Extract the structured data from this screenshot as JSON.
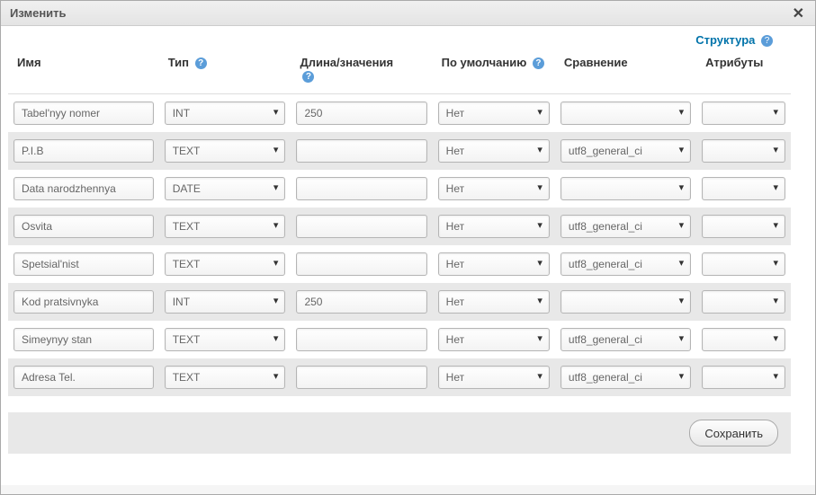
{
  "dialog": {
    "title": "Изменить",
    "close_glyph": "✕"
  },
  "structure_link": {
    "label": "Структура",
    "help": "?"
  },
  "headers": {
    "name": "Имя",
    "type": "Тип",
    "length": "Длина/значения",
    "default": "По умолчанию",
    "collation": "Сравнение",
    "attributes": "Атрибуты",
    "help": "?"
  },
  "rows": [
    {
      "name": "Tabel'nyy nomer",
      "type": "INT",
      "length": "250",
      "default": "Нет",
      "collation": "",
      "attributes": ""
    },
    {
      "name": "P.I.B",
      "type": "TEXT",
      "length": "",
      "default": "Нет",
      "collation": "utf8_general_ci",
      "attributes": ""
    },
    {
      "name": "Data narodzhennya",
      "type": "DATE",
      "length": "",
      "default": "Нет",
      "collation": "",
      "attributes": ""
    },
    {
      "name": "Osvita",
      "type": "TEXT",
      "length": "",
      "default": "Нет",
      "collation": "utf8_general_ci",
      "attributes": ""
    },
    {
      "name": "Spetsial'nist",
      "type": "TEXT",
      "length": "",
      "default": "Нет",
      "collation": "utf8_general_ci",
      "attributes": ""
    },
    {
      "name": "Kod pratsivnyka",
      "type": "INT",
      "length": "250",
      "default": "Нет",
      "collation": "",
      "attributes": ""
    },
    {
      "name": "Simeynyy stan",
      "type": "TEXT",
      "length": "",
      "default": "Нет",
      "collation": "utf8_general_ci",
      "attributes": ""
    },
    {
      "name": "Adresa Tel.",
      "type": "TEXT",
      "length": "",
      "default": "Нет",
      "collation": "utf8_general_ci",
      "attributes": ""
    }
  ],
  "footer": {
    "save": "Сохранить"
  }
}
